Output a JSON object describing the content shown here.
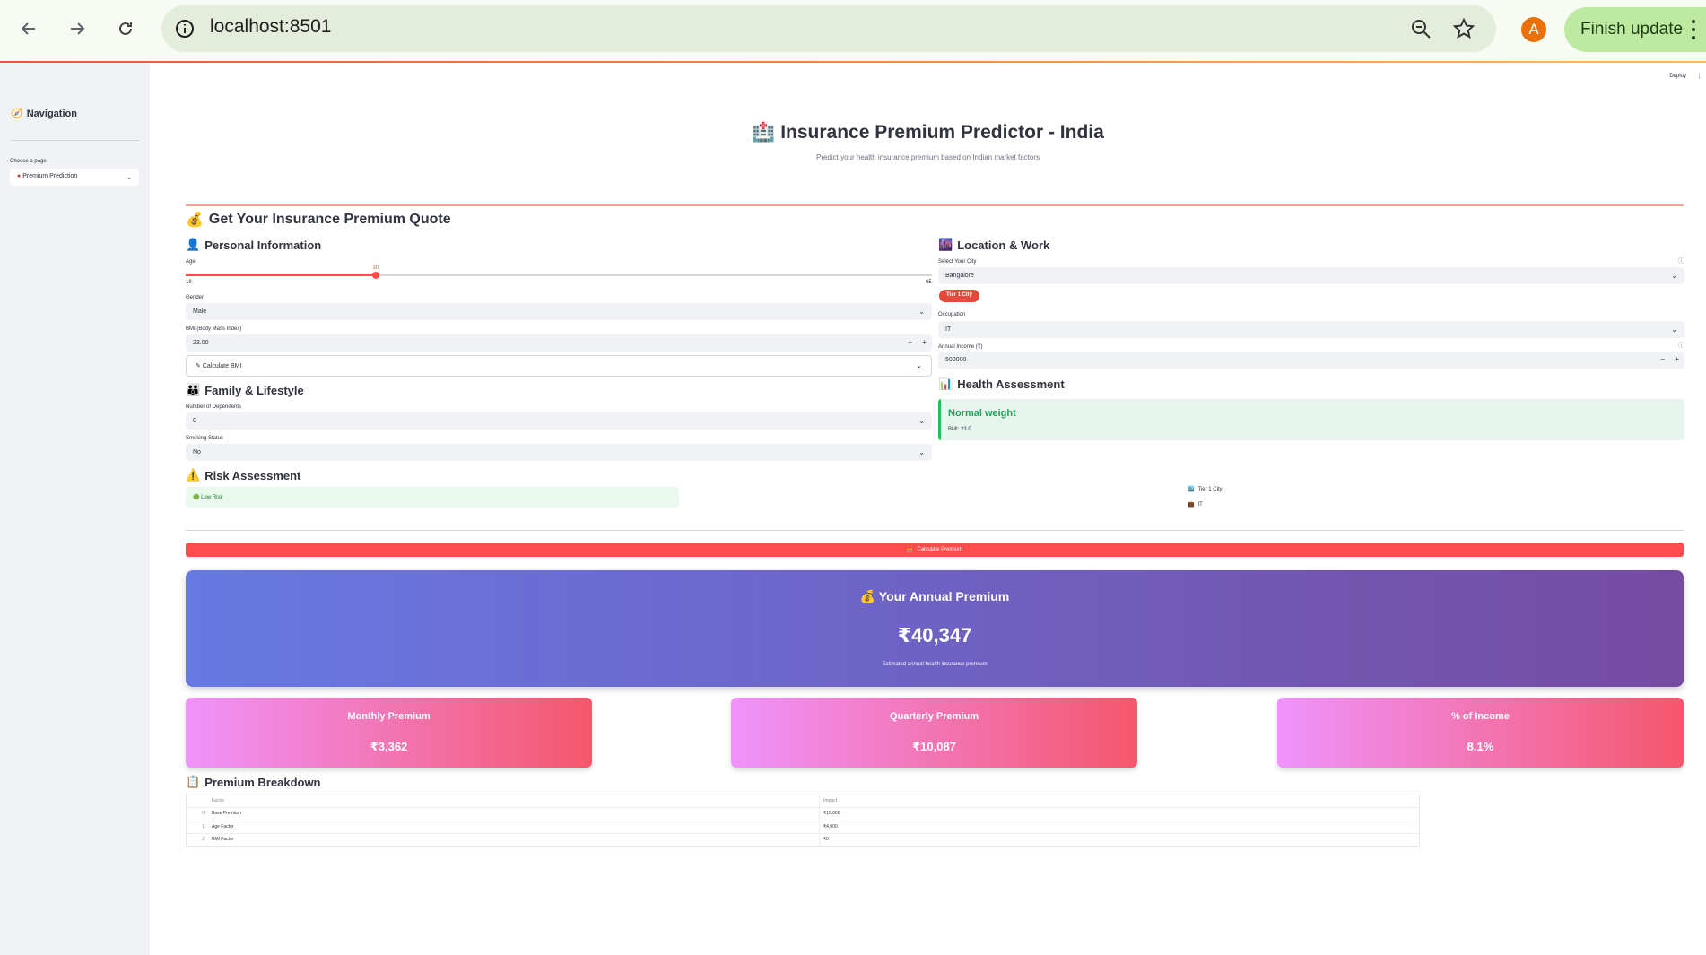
{
  "browser": {
    "url": "localhost:8501",
    "avatar_letter": "A",
    "finish_update": "Finish update"
  },
  "sidebar": {
    "title": "Navigation",
    "select_label": "Choose a page",
    "selected_page": "Premium Prediction"
  },
  "header": {
    "deploy": "Deploy",
    "title": "Insurance Premium Predictor - India",
    "subtitle": "Predict your health insurance premium based on Indian market factors"
  },
  "quote": {
    "heading": "Get Your Insurance Premium Quote"
  },
  "personal": {
    "heading": "Personal Information",
    "age_label": "Age",
    "age_value": 30,
    "age_value_text": "30",
    "age_min": "18",
    "age_max": "65",
    "age_min_num": 18,
    "age_max_num": 65,
    "gender_label": "Gender",
    "gender_value": "Male",
    "bmi_label": "BMI (Body Mass Index)",
    "bmi_value": "23.00",
    "calc_bmi": "Calculate BMI"
  },
  "family": {
    "heading": "Family & Lifestyle",
    "dependents_label": "Number of Dependents",
    "dependents_value": "0",
    "smoking_label": "Smoking Status",
    "smoking_value": "No"
  },
  "location": {
    "heading": "Location & Work",
    "city_label": "Select Your City",
    "city_value": "Bangalore",
    "tier_badge": "Tier 1 City",
    "occupation_label": "Occupation",
    "occupation_value": "IT",
    "income_label": "Annual Income (₹)",
    "income_value": "500000"
  },
  "health": {
    "heading": "Health Assessment",
    "status": "Normal weight",
    "bmi_text": "BMI: 23.0"
  },
  "risk": {
    "heading": "Risk Assessment",
    "level": "Low Risk",
    "tier": "Tier 1 City",
    "occupation": "IT"
  },
  "actions": {
    "calculate": "Calculate Premium"
  },
  "premium": {
    "annual_title": "Your Annual Premium",
    "annual_value": "₹40,347",
    "annual_sub": "Estimated annual health insurance premium",
    "monthly_title": "Monthly Premium",
    "monthly_value": "₹3,362",
    "quarterly_title": "Quarterly Premium",
    "quarterly_value": "₹10,087",
    "income_title": "% of Income",
    "income_value": "8.1%"
  },
  "breakdown": {
    "heading": "Premium Breakdown",
    "columns": [
      "Factor",
      "Impact"
    ],
    "rows": [
      {
        "idx": "0",
        "factor": "Base Premium",
        "impact": "₹15,000"
      },
      {
        "idx": "1",
        "factor": "Age Factor",
        "impact": "₹4,000"
      },
      {
        "idx": "2",
        "factor": "BMI Factor",
        "impact": "₹0"
      }
    ]
  },
  "colors": {
    "primary": "#ff4b4b",
    "annual_gradient": [
      "#6779e3",
      "#764ba2"
    ],
    "card_gradient": [
      "#f093fb",
      "#f5576c"
    ],
    "success": "#21c354"
  }
}
